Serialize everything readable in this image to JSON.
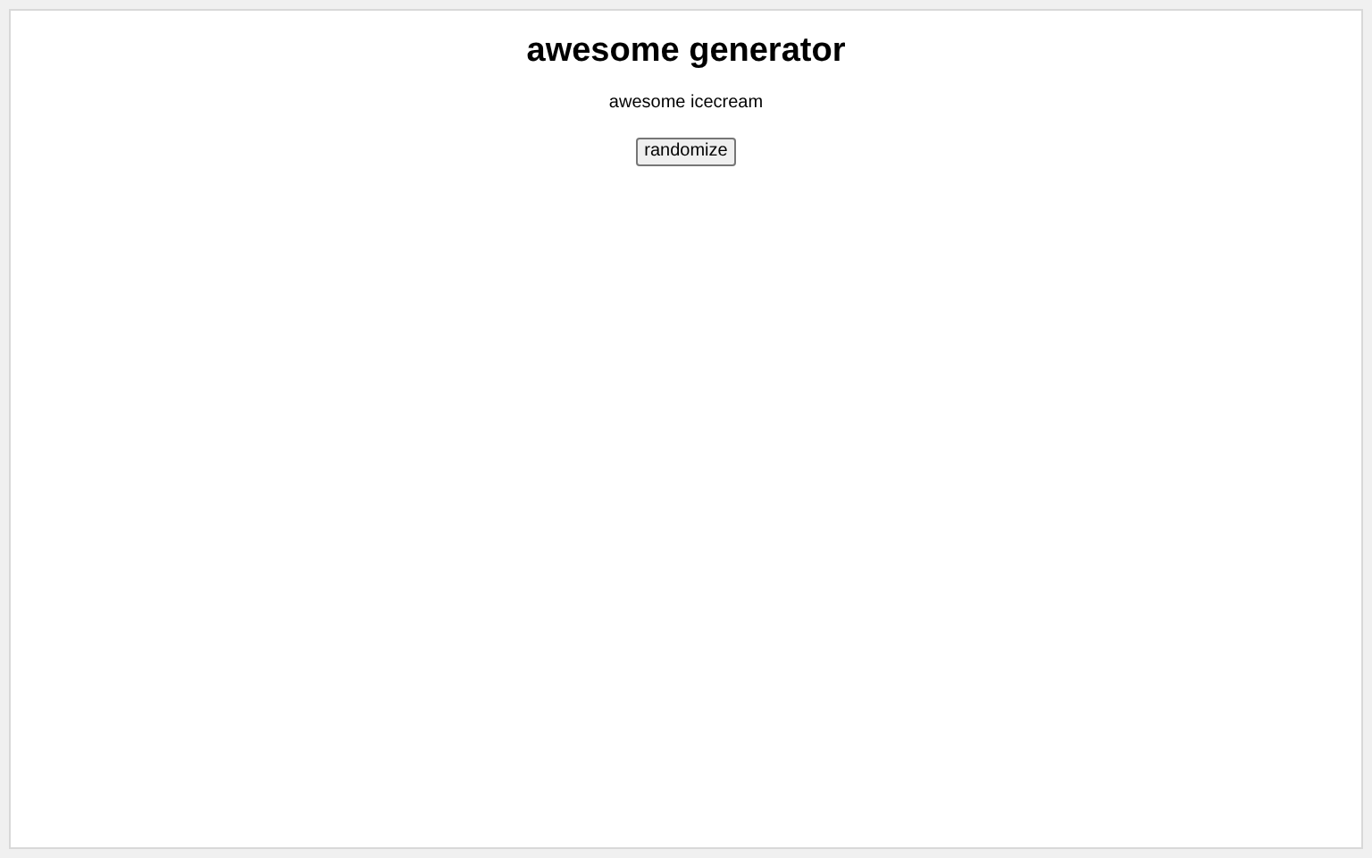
{
  "title": "awesome generator",
  "result": "awesome icecream",
  "button": "randomize"
}
